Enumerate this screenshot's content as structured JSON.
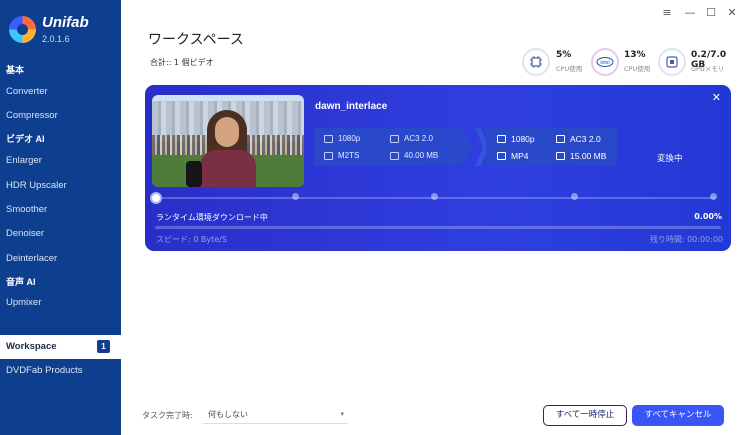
{
  "app": {
    "name": "Unifab",
    "version": "2.0.1.6"
  },
  "window_controls": [
    "≡",
    "—",
    "☐",
    "✕"
  ],
  "sidebar": {
    "items": [
      {
        "label": "基本",
        "type": "section"
      },
      {
        "label": "Converter",
        "type": "item"
      },
      {
        "label": "Compressor",
        "type": "item"
      },
      {
        "label": "ビデオ AI",
        "type": "section"
      },
      {
        "label": "Enlarger",
        "type": "item"
      },
      {
        "label": "HDR Upscaler",
        "type": "item"
      },
      {
        "label": "Smoother",
        "type": "item"
      },
      {
        "label": "Denoiser",
        "type": "item"
      },
      {
        "label": "Deinterlacer",
        "type": "item"
      },
      {
        "label": "音声 AI",
        "type": "section"
      },
      {
        "label": "Upmixer",
        "type": "item"
      },
      {
        "label": "Workspace",
        "type": "active",
        "badge": "1"
      },
      {
        "label": "DVDFab Products",
        "type": "item"
      }
    ]
  },
  "header": {
    "title": "ワークスペース",
    "count_text": "合計:: 1 個ビデオ",
    "stats": [
      {
        "value": "5%",
        "label": "CPU使用",
        "icon": "cpu-icon"
      },
      {
        "value": "13%",
        "label": "CPU使用",
        "icon": "intel-icon"
      },
      {
        "value": "0.2/7.0 GB",
        "label": "GPUメモリ",
        "icon": "gpu-memory-icon"
      }
    ]
  },
  "task": {
    "filename": "dawn_interlace",
    "source": {
      "resolution": "1080p",
      "audio": "AC3 2.0",
      "container": "M2TS",
      "size": "40.00 MB"
    },
    "target": {
      "resolution": "1080p",
      "audio": "AC3 2.0",
      "container": "MP4",
      "size": "15.00 MB"
    },
    "status": "変換中",
    "progress_label": "ランタイム環境ダウンロード中",
    "progress_percent": "0.00%",
    "progress_fraction": 0,
    "speed": "スピード: 0 Byte/S",
    "remaining": "残り時間: 00:00:00"
  },
  "footer": {
    "completion_label": "タスク完了時:",
    "completion_value": "何もしない",
    "pause_all": "すべて一時停止",
    "cancel_all": "すべてキャンセル"
  },
  "colors": {
    "sidebar_bg": "#0e3f8f",
    "card_bg": "#2f3fe0",
    "accent": "#3a55f5"
  }
}
